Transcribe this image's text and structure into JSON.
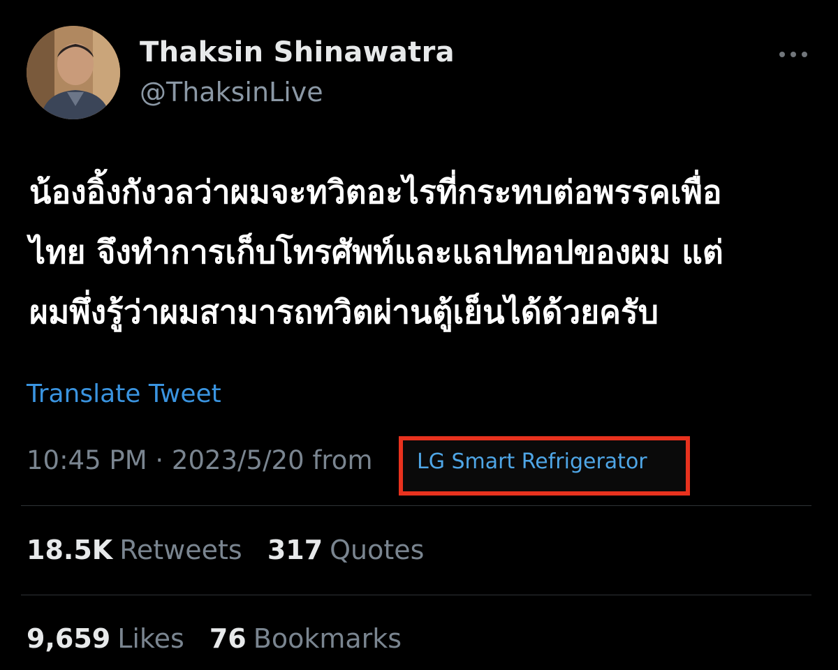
{
  "author": {
    "display_name": "Thaksin Shinawatra",
    "handle": "@ThaksinLive"
  },
  "tweet": {
    "lines": [
      "น้องอิ้งกังวลว่าผมจะทวิตอะไรที่กระทบต่อพรรคเพื่อ",
      "ไทย จึงทำการเก็บโทรศัพท์และแลปทอปของผม แต่",
      "ผมพึ่งรู้ว่าผมสามารถทวิตผ่านตู้เย็นได้ด้วยครับ"
    ],
    "translate_label": "Translate Tweet"
  },
  "meta": {
    "timestamp": "10:45 PM · 2023/5/20 from",
    "source": "LG Smart Refrigerator"
  },
  "stats": {
    "retweets_count": "18.5K",
    "retweets_label": "Retweets",
    "quotes_count": "317",
    "quotes_label": "Quotes",
    "likes_count": "9,659",
    "likes_label": "Likes",
    "bookmarks_count": "76",
    "bookmarks_label": "Bookmarks"
  },
  "colors": {
    "background": "#000000",
    "link": "#3a94e0",
    "highlight_box": "#e8321e",
    "secondary_text": "#7a8590"
  },
  "icons": {
    "more": "more-horizontal-icon"
  }
}
